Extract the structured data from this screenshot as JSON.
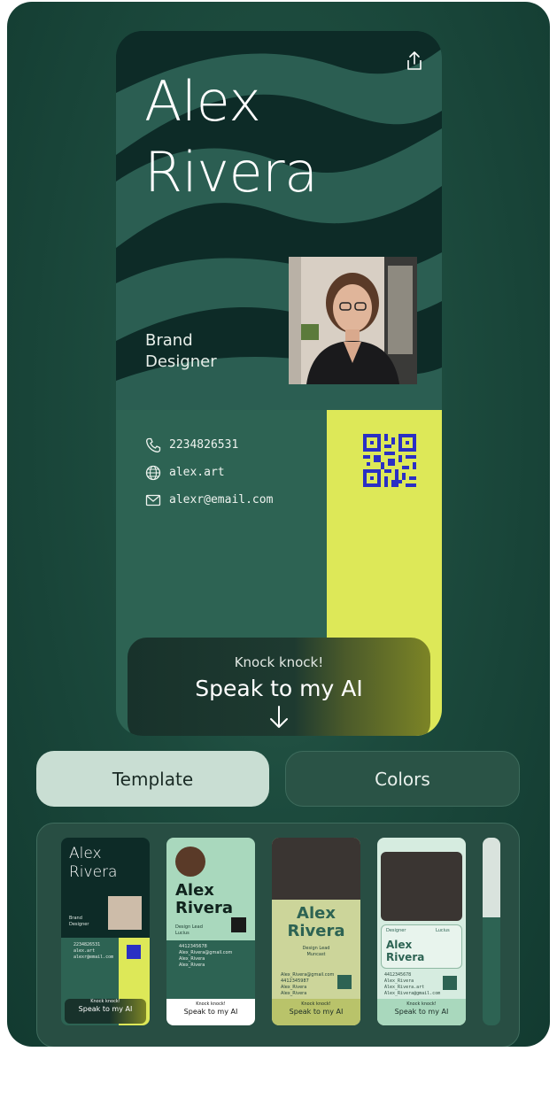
{
  "card": {
    "first_name": "Alex",
    "last_name": "Rivera",
    "role_line1": "Brand",
    "role_line2": "Designer",
    "phone": "2234826531",
    "website": "alex.art",
    "email": "alexr@email.com",
    "cta_small": "Knock knock!",
    "cta_big": "Speak to my AI"
  },
  "tabs": {
    "template": "Template",
    "colors": "Colors"
  },
  "thumbnails": [
    {
      "name1": "Alex",
      "name2": "Rivera",
      "role1": "Brand",
      "role2": "Designer",
      "phone": "2234826531",
      "web": "alex.art",
      "email": "alexr@email.com",
      "cta_small": "Knock knock!",
      "cta_big": "Speak to my AI"
    },
    {
      "name1": "Alex",
      "name2": "Rivera",
      "role": "Design Lead",
      "company": "Lucius",
      "phone": "4412345678",
      "email": "Alex_Rivera@gmail.com",
      "web": "Alex_Rivera",
      "handle": "Alex_Rivera",
      "cta_small": "Knock knock!",
      "cta_big": "Speak to my AI"
    },
    {
      "name1": "Alex",
      "name2": "Rivera",
      "role": "Design Lead",
      "company": "Muncast",
      "email": "Alex_Rivera@gmail.com",
      "phone": "4412345987",
      "web": "Alex_Rivera",
      "handle": "Alex_Rivera",
      "cta_small": "Knock knock!",
      "cta_big": "Speak to my AI"
    },
    {
      "role": "Designer",
      "company": "Lucius",
      "name1": "Alex",
      "name2": "Rivera",
      "phone": "4412345678",
      "handle": "Alex_Rivera",
      "web": "Alex_Rivera.art",
      "email": "Alex_Rivera@gmail.com",
      "cta_small": "Knock knock!",
      "cta_big": "Speak to my AI"
    }
  ],
  "colors": {
    "panel": "#1c4a3d",
    "card_dark": "#0d2b27",
    "card_green": "#2d6353",
    "accent_yellow": "#dde858",
    "qr_blue": "#2a2fc4",
    "tab_active": "#c9ded3"
  },
  "icons": [
    "share-icon",
    "phone-icon",
    "globe-icon",
    "mail-icon",
    "arrow-down-icon",
    "qr-code-icon"
  ]
}
